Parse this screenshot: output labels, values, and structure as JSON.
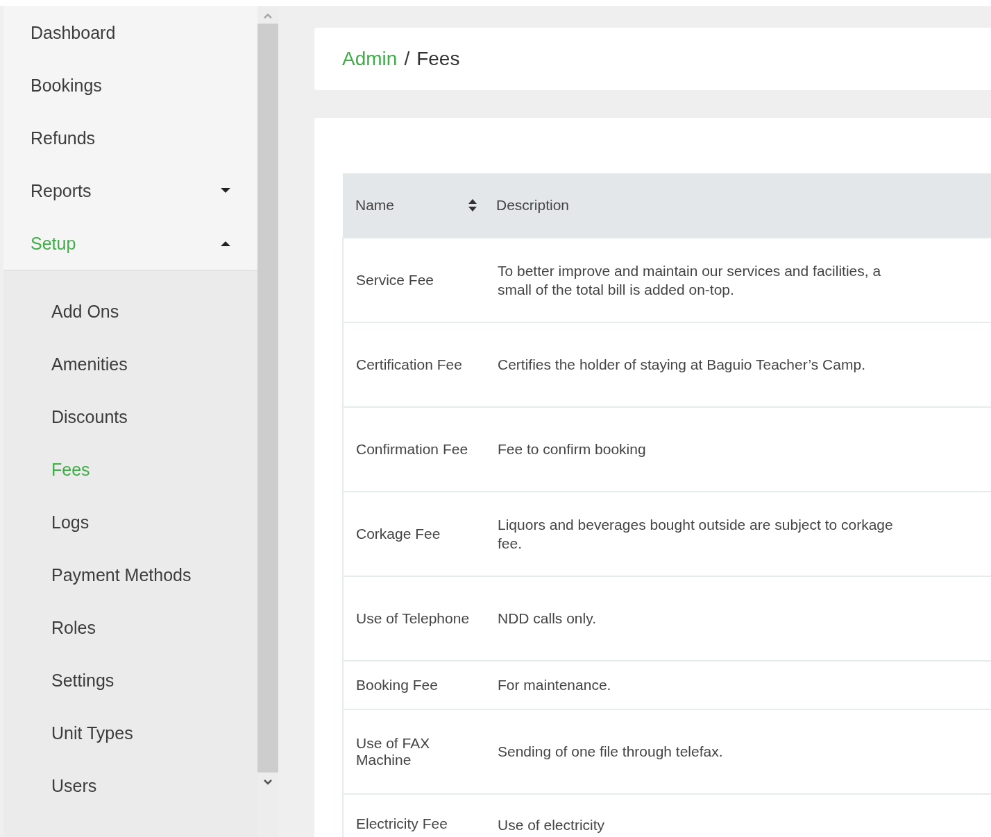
{
  "sidebar": {
    "items": [
      {
        "label": "Dashboard",
        "selected": false
      },
      {
        "label": "Bookings",
        "selected": false
      },
      {
        "label": "Refunds",
        "selected": false
      },
      {
        "label": "Reports",
        "selected": false,
        "expanded": false
      },
      {
        "label": "Setup",
        "selected": true,
        "expanded": true,
        "children": [
          {
            "label": "Add Ons",
            "selected": false
          },
          {
            "label": "Amenities",
            "selected": false
          },
          {
            "label": "Discounts",
            "selected": false
          },
          {
            "label": "Fees",
            "selected": true
          },
          {
            "label": "Logs",
            "selected": false
          },
          {
            "label": "Payment Methods",
            "selected": false
          },
          {
            "label": "Roles",
            "selected": false
          },
          {
            "label": "Settings",
            "selected": false
          },
          {
            "label": "Unit Types",
            "selected": false
          },
          {
            "label": "Users",
            "selected": false
          }
        ]
      }
    ]
  },
  "breadcrumb": {
    "separator": "/",
    "items": [
      {
        "label": "Admin",
        "kind": "link"
      },
      {
        "label": "Fees",
        "kind": "current"
      }
    ]
  },
  "table": {
    "columns": [
      {
        "label": "Name",
        "sortable": true
      },
      {
        "label": "Description",
        "sortable": false
      }
    ],
    "rows": [
      {
        "kind": "normal",
        "cells": [
          "Service Fee",
          "To better improve and maintain our services and facilities, a small of the total bill is added on-top."
        ]
      },
      {
        "kind": "normal",
        "cells": [
          "Certification Fee",
          "Certifies the holder of staying at Baguio Teacher’s Camp."
        ]
      },
      {
        "kind": "normal",
        "cells": [
          "Confirmation Fee",
          "Fee to confirm booking"
        ]
      },
      {
        "kind": "normal",
        "cells": [
          "Corkage Fee",
          "Liquors and beverages bought outside are subject to corkage fee."
        ]
      },
      {
        "kind": "normal",
        "cells": [
          "Use of Telephone",
          "NDD calls only."
        ]
      },
      {
        "kind": "compact",
        "cells": [
          "Booking Fee",
          "For maintenance."
        ]
      },
      {
        "kind": "normal",
        "cells": [
          "Use of FAX Machine",
          "Sending of one file through telefax."
        ]
      },
      {
        "kind": "normal",
        "cells": [
          "Electricity Fee",
          "Use of electricity"
        ]
      }
    ]
  }
}
